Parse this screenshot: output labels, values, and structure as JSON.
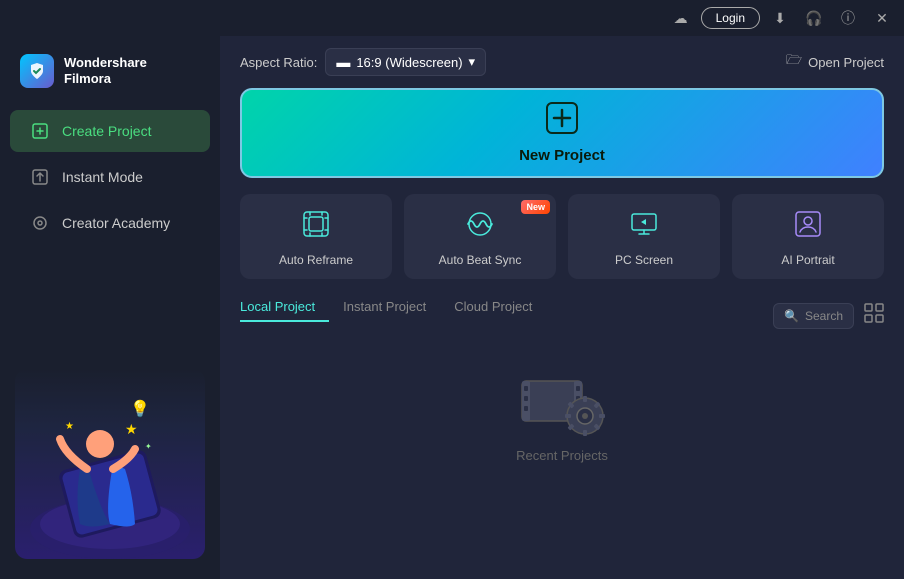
{
  "titlebar": {
    "login_label": "Login"
  },
  "sidebar": {
    "brand": "Wondershare",
    "product": "Filmora",
    "nav_items": [
      {
        "id": "create-project",
        "label": "Create Project",
        "icon": "➕",
        "active": true
      },
      {
        "id": "instant-mode",
        "label": "Instant Mode",
        "icon": "⊕",
        "active": false
      },
      {
        "id": "creator-academy",
        "label": "Creator Academy",
        "icon": "◎",
        "active": false
      }
    ]
  },
  "header": {
    "aspect_ratio_label": "Aspect Ratio:",
    "aspect_ratio_value": "16:9 (Widescreen)",
    "open_project_label": "Open Project"
  },
  "new_project": {
    "label": "New Project"
  },
  "tool_cards": [
    {
      "id": "auto-reframe",
      "label": "Auto Reframe",
      "icon": "⊡",
      "color": "teal",
      "new": false
    },
    {
      "id": "auto-beat-sync",
      "label": "Auto Beat Sync",
      "icon": "⊛",
      "color": "teal",
      "new": true
    },
    {
      "id": "pc-screen",
      "label": "PC Screen",
      "icon": "▷",
      "color": "teal",
      "new": false
    },
    {
      "id": "ai-portrait",
      "label": "AI Portrait",
      "icon": "⊡",
      "color": "purple",
      "new": false
    }
  ],
  "project_tabs": [
    {
      "id": "local",
      "label": "Local Project",
      "active": true
    },
    {
      "id": "instant",
      "label": "Instant Project",
      "active": false
    },
    {
      "id": "cloud",
      "label": "Cloud Project",
      "active": false
    }
  ],
  "search": {
    "placeholder": "Search"
  },
  "empty_state": {
    "label": "Recent Projects"
  },
  "new_badge": "New"
}
